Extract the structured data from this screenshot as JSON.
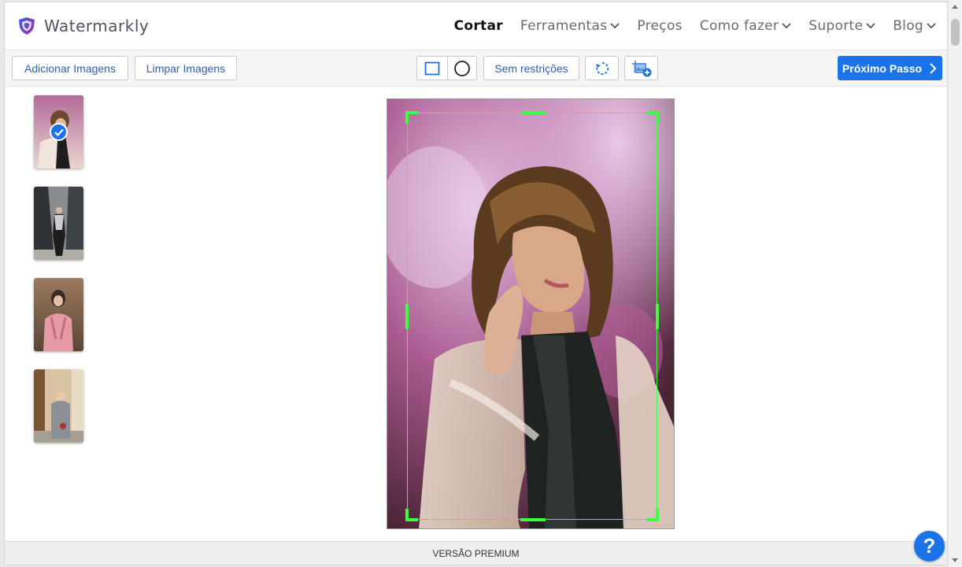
{
  "app": {
    "name": "Watermarkly",
    "accent": "#1a73e8"
  },
  "nav": [
    {
      "label": "Cortar",
      "active": true,
      "dropdown": false
    },
    {
      "label": "Ferramentas",
      "active": false,
      "dropdown": true
    },
    {
      "label": "Preços",
      "active": false,
      "dropdown": false
    },
    {
      "label": "Como fazer",
      "active": false,
      "dropdown": true
    },
    {
      "label": "Suporte",
      "active": false,
      "dropdown": true
    },
    {
      "label": "Blog",
      "active": false,
      "dropdown": true
    }
  ],
  "toolbar": {
    "add_images": "Adicionar Imagens",
    "clear_images": "Limpar Imagens",
    "shape_rect": "square-shape-icon",
    "shape_circle": "circle-shape-icon",
    "aspect": "Sem restrições",
    "rotate": "rotate-icon",
    "add_crop": "add-crop-icon",
    "next": "Próximo Passo"
  },
  "thumbnails": [
    {
      "name": "thumb-1",
      "selected": true
    },
    {
      "name": "thumb-2",
      "selected": false
    },
    {
      "name": "thumb-3",
      "selected": false
    },
    {
      "name": "thumb-4",
      "selected": false
    }
  ],
  "crop_color": "#3dff3d",
  "footer": {
    "label": "VERSÃO PREMIUM"
  },
  "help": {
    "label": "?"
  }
}
